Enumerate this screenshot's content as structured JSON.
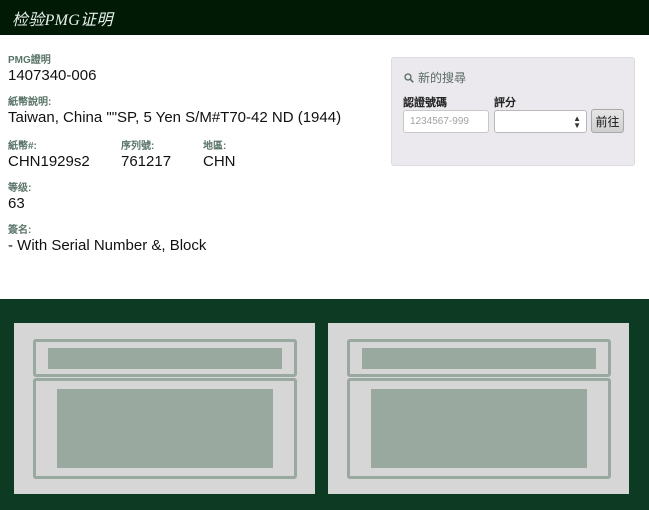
{
  "header": {
    "title": "检验PMG证明"
  },
  "details": {
    "cert_label": "PMG證明",
    "cert_value": "1407340-006",
    "note_label": "紙幣說明:",
    "note_value": "Taiwan, China \"\"SP, 5 Yen S/M#T70-42 ND (1944)",
    "pick_label": "紙幣#:",
    "pick_value": "CHN1929s2",
    "serial_label": "序列號:",
    "serial_value": "761217",
    "region_label": "地區:",
    "region_value": "CHN",
    "grade_label": "等级:",
    "grade_value": "63",
    "signature_label": "簽名:",
    "signature_value": "- With Serial Number &, Block"
  },
  "search": {
    "title": "新的搜尋",
    "cert_label": "認證號碼",
    "cert_placeholder": "1234567-999",
    "grade_label": "評分",
    "grade_selected": "",
    "go_label": "前往"
  },
  "colors": {
    "header_bg": "#001a06",
    "footer_bg": "#0c3a22",
    "label_green": "#5a7569",
    "placeholder_gray": "#99a99f"
  }
}
